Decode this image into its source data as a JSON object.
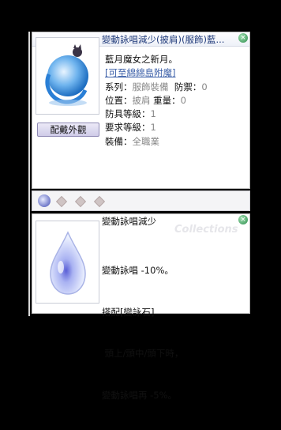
{
  "equip_card": {
    "title": "變動詠唱減少(披肩)(服飾)藍...",
    "close_icon": "×",
    "appearance_button": "配戴外觀",
    "description": "藍月魔女之新月。",
    "enchant_link": "[可至綿綿島附魔]",
    "stats": [
      {
        "label": "系列：",
        "value": "服飾裝備",
        "label2": "防禦：",
        "value2": "0"
      },
      {
        "label": "位置：",
        "value": "披肩",
        "label2": "重量：",
        "value2": "0"
      },
      {
        "label": "防具等級：",
        "value": "1"
      },
      {
        "label": "要求等級：",
        "value": "1"
      },
      {
        "label": "裝備：",
        "value": "全職業"
      }
    ]
  },
  "card_detail": {
    "title": "變動詠唱減少",
    "watermark": "Collections",
    "close_icon": "×",
    "lines": [
      "變動詠唱 -10%。",
      "搭配[變詠石]",
      " 頭上/頭中/頭下時，",
      "變動詠唱再 -5%。"
    ]
  },
  "colors": {
    "title_text": "#1f3a7a",
    "link": "#3b5fa8",
    "close_button": "#2f8d4e"
  }
}
